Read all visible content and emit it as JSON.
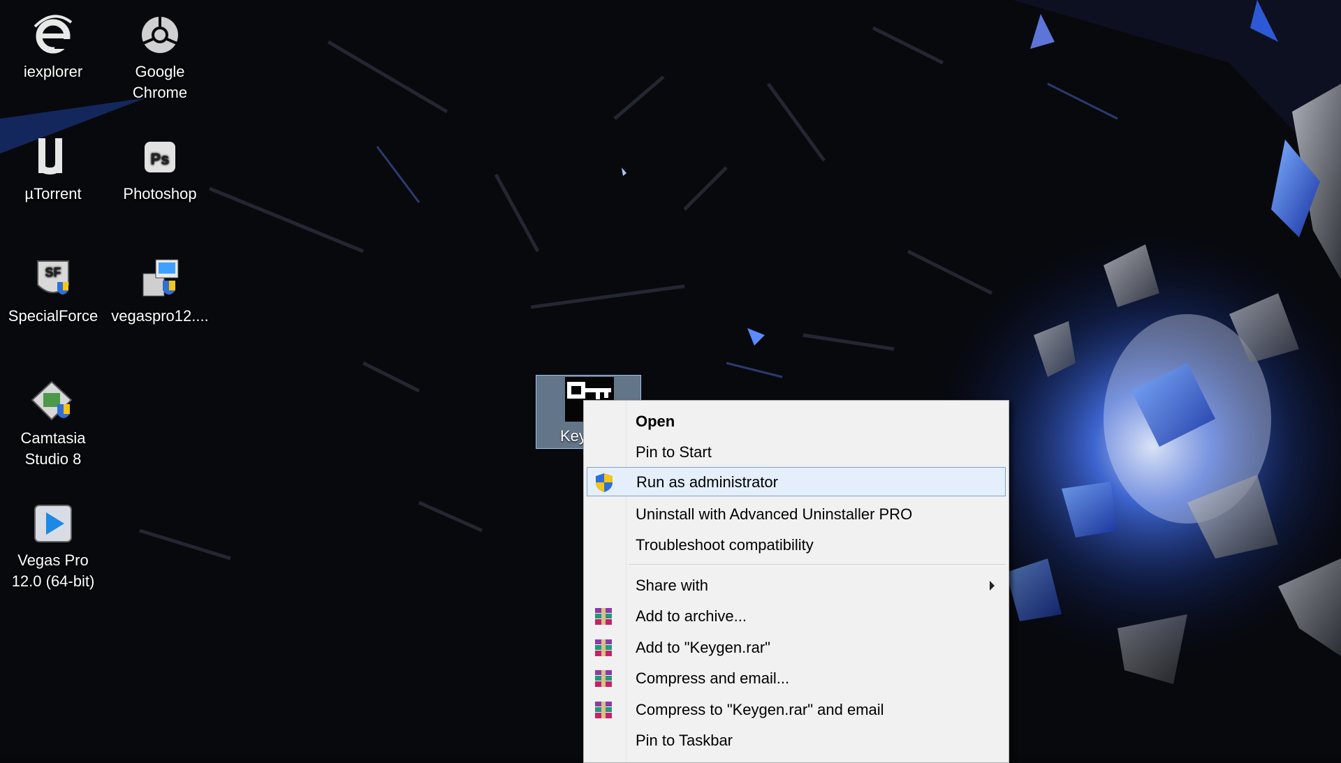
{
  "desktop": {
    "icons": [
      {
        "label": "iexplorer",
        "icon": "internet-explorer-icon"
      },
      {
        "label": "Google Chrome",
        "icon": "chrome-icon"
      },
      {
        "label": "µTorrent",
        "icon": "utorrent-icon"
      },
      {
        "label": "Photoshop",
        "icon": "photoshop-icon"
      },
      {
        "label": "SpecialForce",
        "icon": "specialforce-icon"
      },
      {
        "label": "vegaspro12....",
        "icon": "installer-icon"
      },
      {
        "label": "Camtasia Studio 8",
        "icon": "camtasia-icon"
      },
      {
        "label": "Vegas Pro 12.0 (64-bit)",
        "icon": "vegas-pro-icon"
      }
    ],
    "selected_file": {
      "label": "Key",
      "icon": "keygen-icon"
    }
  },
  "context_menu": {
    "items": [
      {
        "label": "Open",
        "bold": true
      },
      {
        "label": "Pin to Start"
      },
      {
        "label": "Run as administrator",
        "icon": "uac-shield-icon",
        "highlighted": true
      },
      {
        "label": "Uninstall with Advanced Uninstaller PRO"
      },
      {
        "label": "Troubleshoot compatibility"
      },
      {
        "label": "Share with",
        "submenu": true
      },
      {
        "label": "Add to archive...",
        "icon": "winrar-icon"
      },
      {
        "label": "Add to \"Keygen.rar\"",
        "icon": "winrar-icon"
      },
      {
        "label": "Compress and email...",
        "icon": "winrar-icon"
      },
      {
        "label": "Compress to \"Keygen.rar\" and email",
        "icon": "winrar-icon"
      },
      {
        "label": "Pin to Taskbar"
      }
    ]
  },
  "colors": {
    "menu_background": "#f1f1f1",
    "menu_highlight": "#e5effb",
    "menu_highlight_border": "#7da2ce",
    "selection": "#adcdf0",
    "wallpaper_accent": "#3a6cff"
  }
}
